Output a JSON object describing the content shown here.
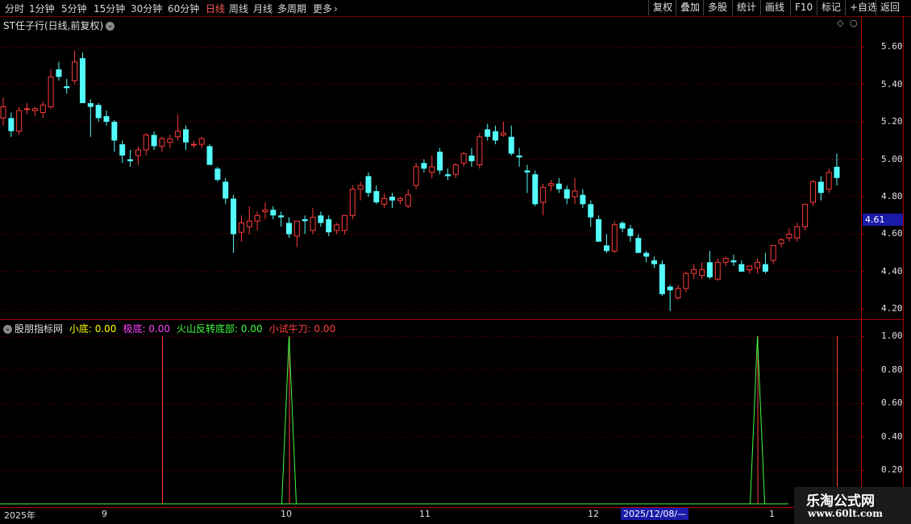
{
  "toolbar": {
    "tabs": [
      "分时",
      "1分钟",
      "5分钟",
      "15分钟",
      "30分钟",
      "60分钟",
      "日线",
      "周线",
      "月线",
      "多周期",
      "更多"
    ],
    "active_tab": "日线",
    "right_buttons": [
      "复权",
      "叠加",
      "多股",
      "统计",
      "画线",
      "F10",
      "标记",
      "+自选",
      "返回"
    ]
  },
  "chart_header": {
    "title": "ST任子行(日线,前复权)"
  },
  "indicator": {
    "name": "股朋指标网",
    "items": [
      {
        "label": "小底:",
        "value": "0.00",
        "color": "#ffff00"
      },
      {
        "label": "极底:",
        "value": "0.00",
        "color": "#ff40ff"
      },
      {
        "label": "火山反转底部:",
        "value": "0.00",
        "color": "#40ff40"
      },
      {
        "label": "小试牛刀:",
        "value": "0.00",
        "color": "#ff4040"
      }
    ]
  },
  "price_axis": [
    "5.60",
    "5.40",
    "5.20",
    "5.00",
    "4.80",
    "4.60",
    "4.40",
    "4.20"
  ],
  "indicator_axis": [
    "1.00",
    "0.80",
    "0.60",
    "0.40",
    "0.20"
  ],
  "current_price": "4.61",
  "date_axis": {
    "labels": [
      "2025年",
      "9",
      "10",
      "11",
      "12",
      "1"
    ],
    "cursor_date": "2025/12/08/—"
  },
  "watermark": {
    "line1": "乐淘公式网",
    "line2": "www.60lt.com"
  },
  "colors": {
    "up": "#ff3b3b",
    "down": "#54fcfc",
    "grid": "#7a0000",
    "bg": "#000000"
  },
  "chart_data": {
    "type": "candlestick",
    "ylim": [
      4.15,
      5.7
    ],
    "candles": [
      [
        5.22,
        5.33,
        5.18,
        5.28
      ],
      [
        5.22,
        5.25,
        5.12,
        5.15
      ],
      [
        5.15,
        5.28,
        5.13,
        5.26
      ],
      [
        5.27,
        5.3,
        5.24,
        5.27
      ],
      [
        5.26,
        5.28,
        5.23,
        5.27
      ],
      [
        5.25,
        5.31,
        5.22,
        5.29
      ],
      [
        5.28,
        5.48,
        5.27,
        5.44
      ],
      [
        5.48,
        5.52,
        5.42,
        5.44
      ],
      [
        5.39,
        5.43,
        5.35,
        5.38
      ],
      [
        5.42,
        5.58,
        5.4,
        5.52
      ],
      [
        5.54,
        5.57,
        5.32,
        5.3
      ],
      [
        5.3,
        5.32,
        5.12,
        5.28
      ],
      [
        5.29,
        5.3,
        5.2,
        5.22
      ],
      [
        5.23,
        5.26,
        5.18,
        5.2
      ],
      [
        5.2,
        5.21,
        5.04,
        5.1
      ],
      [
        5.08,
        5.1,
        4.98,
        5.02
      ],
      [
        5.0,
        5.05,
        4.96,
        4.99
      ],
      [
        5.02,
        5.07,
        4.97,
        5.05
      ],
      [
        5.05,
        5.14,
        5.02,
        5.13
      ],
      [
        5.13,
        5.15,
        5.05,
        5.07
      ],
      [
        5.07,
        5.12,
        5.04,
        5.11
      ],
      [
        5.09,
        5.13,
        5.06,
        5.11
      ],
      [
        5.12,
        5.24,
        5.1,
        5.15
      ],
      [
        5.16,
        5.18,
        5.05,
        5.09
      ],
      [
        5.08,
        5.1,
        5.06,
        5.08
      ],
      [
        5.08,
        5.12,
        5.06,
        5.11
      ],
      [
        5.07,
        5.08,
        4.99,
        4.97
      ],
      [
        4.95,
        4.96,
        4.88,
        4.89
      ],
      [
        4.88,
        4.9,
        4.76,
        4.79
      ],
      [
        4.79,
        4.81,
        4.5,
        4.6
      ],
      [
        4.61,
        4.7,
        4.56,
        4.66
      ],
      [
        4.64,
        4.75,
        4.6,
        4.67
      ],
      [
        4.67,
        4.72,
        4.62,
        4.7
      ],
      [
        4.72,
        4.77,
        4.68,
        4.73
      ],
      [
        4.73,
        4.75,
        4.68,
        4.7
      ],
      [
        4.7,
        4.72,
        4.64,
        4.69
      ],
      [
        4.66,
        4.69,
        4.58,
        4.6
      ],
      [
        4.59,
        4.62,
        4.53,
        4.67
      ],
      [
        4.68,
        4.7,
        4.6,
        4.67
      ],
      [
        4.62,
        4.74,
        4.6,
        4.69
      ],
      [
        4.7,
        4.72,
        4.64,
        4.66
      ],
      [
        4.68,
        4.7,
        4.59,
        4.61
      ],
      [
        4.62,
        4.66,
        4.6,
        4.65
      ],
      [
        4.62,
        4.7,
        4.6,
        4.7
      ],
      [
        4.7,
        4.86,
        4.68,
        4.84
      ],
      [
        4.84,
        4.88,
        4.78,
        4.86
      ],
      [
        4.91,
        4.93,
        4.8,
        4.82
      ],
      [
        4.83,
        4.86,
        4.76,
        4.77
      ],
      [
        4.76,
        4.82,
        4.74,
        4.79
      ],
      [
        4.8,
        4.82,
        4.74,
        4.78
      ],
      [
        4.78,
        4.8,
        4.76,
        4.79
      ],
      [
        4.75,
        4.84,
        4.74,
        4.81
      ],
      [
        4.86,
        4.98,
        4.84,
        4.96
      ],
      [
        4.98,
        5.0,
        4.93,
        4.95
      ],
      [
        4.93,
        5.02,
        4.9,
        4.96
      ],
      [
        5.04,
        5.06,
        4.92,
        4.94
      ],
      [
        4.92,
        4.95,
        4.89,
        4.91
      ],
      [
        4.92,
        4.98,
        4.9,
        4.97
      ],
      [
        4.98,
        5.04,
        4.96,
        5.03
      ],
      [
        5.02,
        5.06,
        4.96,
        4.99
      ],
      [
        4.97,
        5.14,
        4.95,
        5.12
      ],
      [
        5.16,
        5.19,
        5.1,
        5.12
      ],
      [
        5.15,
        5.18,
        5.08,
        5.1
      ],
      [
        5.13,
        5.2,
        5.12,
        5.14
      ],
      [
        5.12,
        5.18,
        5.02,
        5.03
      ],
      [
        5.02,
        5.06,
        4.96,
        5.01
      ],
      [
        4.94,
        4.97,
        4.82,
        4.93
      ],
      [
        4.92,
        4.94,
        4.75,
        4.76
      ],
      [
        4.77,
        4.87,
        4.7,
        4.85
      ],
      [
        4.86,
        4.89,
        4.83,
        4.87
      ],
      [
        4.87,
        4.9,
        4.82,
        4.84
      ],
      [
        4.84,
        4.86,
        4.76,
        4.79
      ],
      [
        4.8,
        4.9,
        4.76,
        4.83
      ],
      [
        4.81,
        4.84,
        4.74,
        4.76
      ],
      [
        4.76,
        4.78,
        4.64,
        4.69
      ],
      [
        4.68,
        4.7,
        4.56,
        4.56
      ],
      [
        4.54,
        4.6,
        4.5,
        4.51
      ],
      [
        4.51,
        4.67,
        4.5,
        4.65
      ],
      [
        4.66,
        4.67,
        4.61,
        4.63
      ],
      [
        4.63,
        4.65,
        4.56,
        4.59
      ],
      [
        4.58,
        4.6,
        4.5,
        4.5
      ],
      [
        4.5,
        4.51,
        4.45,
        4.48
      ],
      [
        4.46,
        4.48,
        4.42,
        4.44
      ],
      [
        4.44,
        4.46,
        4.27,
        4.28
      ],
      [
        4.32,
        4.33,
        4.19,
        4.3
      ],
      [
        4.26,
        4.33,
        4.25,
        4.31
      ],
      [
        4.31,
        4.4,
        4.29,
        4.39
      ],
      [
        4.39,
        4.44,
        4.36,
        4.41
      ],
      [
        4.38,
        4.45,
        4.36,
        4.41
      ],
      [
        4.45,
        4.51,
        4.36,
        4.37
      ],
      [
        4.36,
        4.47,
        4.35,
        4.45
      ],
      [
        4.45,
        4.48,
        4.43,
        4.47
      ],
      [
        4.46,
        4.49,
        4.43,
        4.45
      ],
      [
        4.44,
        4.46,
        4.4,
        4.4
      ],
      [
        4.41,
        4.43,
        4.39,
        4.43
      ],
      [
        4.42,
        4.47,
        4.39,
        4.45
      ],
      [
        4.44,
        4.5,
        4.39,
        4.4
      ],
      [
        4.46,
        4.54,
        4.44,
        4.54
      ],
      [
        4.55,
        4.58,
        4.53,
        4.57
      ],
      [
        4.58,
        4.63,
        4.56,
        4.6
      ],
      [
        4.58,
        4.66,
        4.56,
        4.64
      ],
      [
        4.64,
        4.74,
        4.62,
        4.76
      ],
      [
        4.77,
        4.89,
        4.75,
        4.88
      ],
      [
        4.88,
        4.91,
        4.78,
        4.82
      ],
      [
        4.84,
        4.95,
        4.82,
        4.93
      ],
      [
        4.96,
        5.03,
        4.86,
        4.9
      ]
    ],
    "indicator_series": [
      {
        "name": "火山反转底部",
        "color": "#40ff40",
        "spikes": [
          {
            "index": 36,
            "value": 1.0
          },
          {
            "index": 95,
            "value": 1.0
          }
        ]
      },
      {
        "name": "小试牛刀",
        "color": "#ff4040",
        "vlines": [
          20,
          36,
          95,
          105
        ]
      }
    ],
    "indicator_ylim": [
      0,
      1.05
    ]
  }
}
